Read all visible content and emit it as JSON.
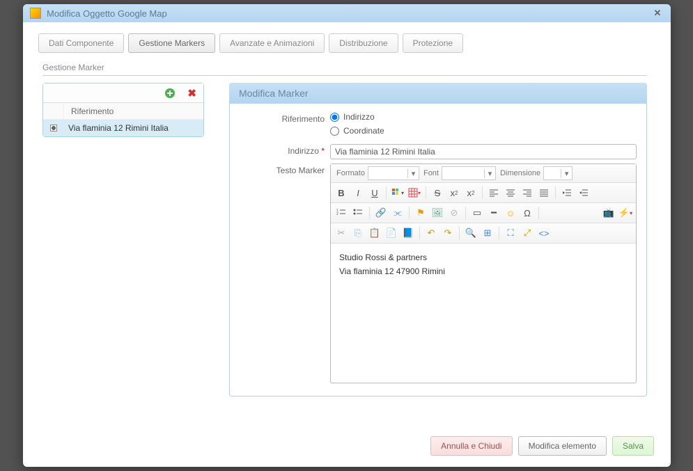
{
  "dialog": {
    "title": "Modifica Oggetto Google Map"
  },
  "tabs": [
    {
      "label": "Dati Componente"
    },
    {
      "label": "Gestione Markers"
    },
    {
      "label": "Avanzate e Animazioni"
    },
    {
      "label": "Distribuzione"
    },
    {
      "label": "Protezione"
    }
  ],
  "active_tab_index": 1,
  "section": {
    "title": "Gestione Marker"
  },
  "marker_list": {
    "header": "Riferimento",
    "items": [
      {
        "label": "Via flaminia 12 Rimini Italia"
      }
    ]
  },
  "marker_form": {
    "title": "Modifica Marker",
    "labels": {
      "riferimento": "Riferimento",
      "indirizzo": "Indirizzo",
      "testo_marker": "Testo Marker"
    },
    "riferimento_options": {
      "indirizzo": "Indirizzo",
      "coordinate": "Coordinate"
    },
    "riferimento_selected": "indirizzo",
    "indirizzo_value": "Via flaminia 12 Rimini Italia",
    "editor": {
      "toolbar_labels": {
        "formato": "Formato",
        "font": "Font",
        "dimensione": "Dimensione"
      },
      "content_lines": [
        "Studio Rossi & partners",
        "Via flaminia 12 47900 Rimini"
      ]
    }
  },
  "buttons": {
    "cancel": "Annulla e Chiudi",
    "modify": "Modifica elemento",
    "save": "Salva"
  }
}
